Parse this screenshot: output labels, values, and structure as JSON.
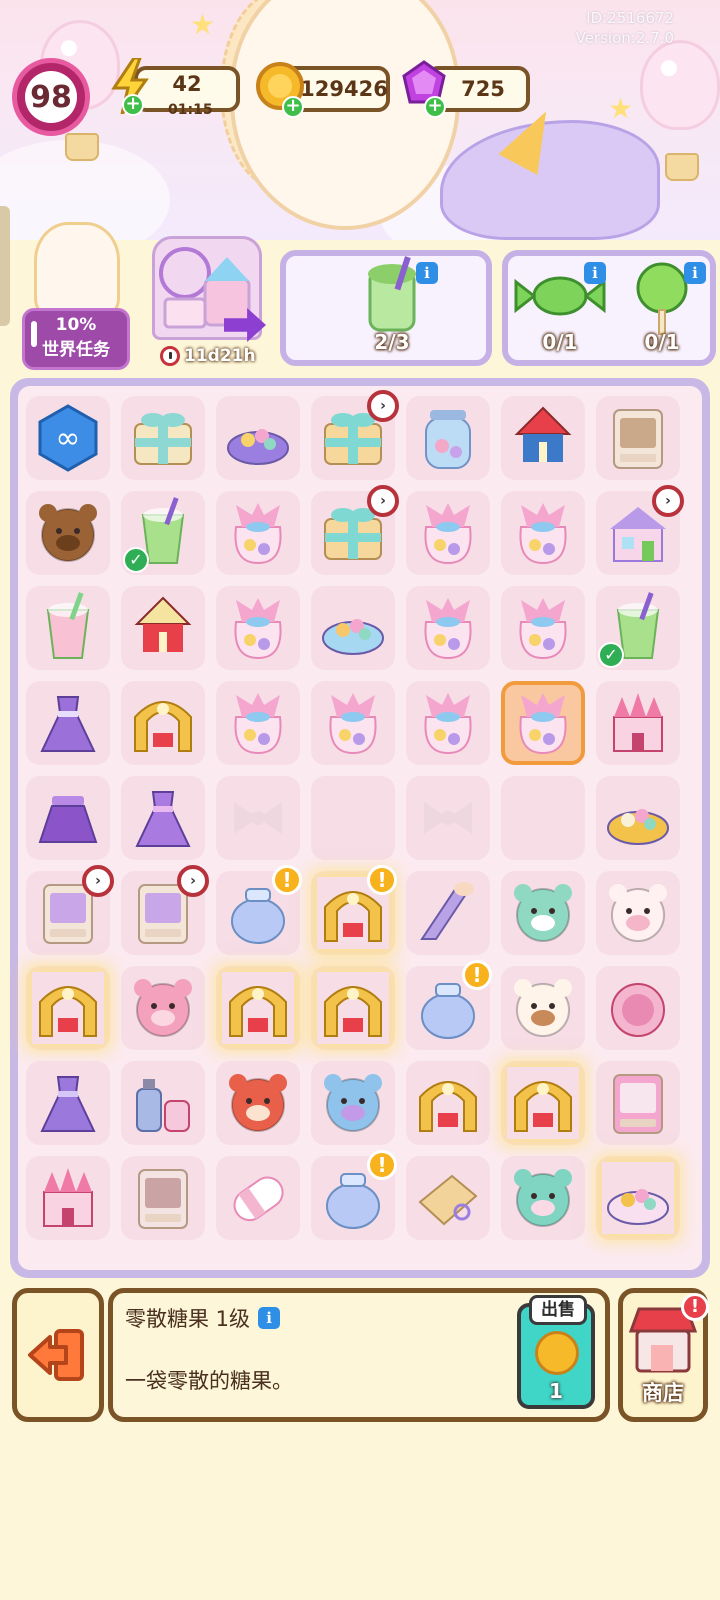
{
  "dev": {
    "id": "ID:2516672",
    "version": "Version:2.7.0"
  },
  "hud": {
    "level": "98",
    "energy": "42",
    "energy_timer": "01:15",
    "coins": "129426",
    "gems": "725"
  },
  "tasks": {
    "world_percent": "10%",
    "world_label": "世界任务",
    "event_timer": "11d21h"
  },
  "orders": [
    {
      "items": [
        {
          "icon": "matcha-drink-icon",
          "count": "2/3"
        }
      ]
    },
    {
      "items": [
        {
          "icon": "green-candy-icon",
          "count": "0/1"
        },
        {
          "icon": "green-lollipop-icon",
          "count": "0/1"
        }
      ]
    }
  ],
  "board": {
    "cols": 7,
    "rows": 9,
    "selected": [
      3,
      5
    ],
    "cells": [
      [
        "infinity-hexagon-icon",
        "teal-ribbon-gift-icon",
        "candy-tray-icon",
        "teal-gift-box-icon",
        "candy-jar-icon",
        "swing-ride-icon",
        "dresser-icon"
      ],
      [
        "teddy-bear-icon",
        "matcha-drink-icon",
        "candy-bag-icon",
        "teal-gift-box-icon",
        "candy-bag-icon",
        "candy-bag-icon",
        "purple-shop-icon"
      ],
      [
        "strawberry-drink-icon",
        "carousel-icon",
        "candy-bag-icon",
        "candy-plate-icon",
        "candy-bag-icon",
        "candy-bag-icon",
        "matcha-drink-icon"
      ],
      [
        "purple-dress-icon",
        "golden-stage-icon",
        "candy-bag-icon",
        "candy-bag-icon",
        "candy-bag-icon",
        "candy-bag-icon",
        "pink-castle-icon"
      ],
      [
        "purple-skirt-icon",
        "purple-jacket-icon",
        "bow-icon",
        "",
        "bow-icon",
        "",
        "teacup-ride-icon"
      ],
      [
        "wardrobe-icon",
        "wardrobe-icon",
        "glass-jar-icon",
        "golden-stage-icon",
        "makeup-brush-icon",
        "seal-plush-icon",
        "sheep-plush-icon"
      ],
      [
        "golden-stage-icon",
        "bunny-plush-icon",
        "golden-stage-icon",
        "golden-stage-icon",
        "glass-jar-icon",
        "puppy-plush-icon",
        "compact-mirror-icon"
      ],
      [
        "purple-gown-icon",
        "perfume-set-icon",
        "hamster-plush-icon",
        "cat-plush-icon",
        "golden-stage-icon",
        "golden-stage-icon",
        "makeup-palette-icon"
      ],
      [
        "pink-castle-icon",
        "nightstand-icon",
        "marshmallow-icon",
        "glass-jar-icon",
        "sewing-pattern-icon",
        "elephant-plush-icon",
        "ride-parts-icon"
      ]
    ],
    "markers": {
      "check": [
        "1-1",
        "2-6"
      ],
      "cooldown": [
        "0-3",
        "1-3",
        "1-6",
        "5-0",
        "5-1"
      ],
      "alert": [
        "5-2",
        "5-3",
        "6-4",
        "8-3"
      ],
      "glow": [
        "5-3",
        "6-0",
        "6-2",
        "6-3",
        "7-5",
        "8-6"
      ],
      "dim": [
        "4-2",
        "4-4"
      ]
    }
  },
  "selected_item": {
    "name": "零散糖果 1级",
    "description": "一袋零散的糖果。",
    "sell_label": "出售",
    "sell_price": "1"
  },
  "shop": {
    "label": "商店"
  },
  "colors": {
    "board_border": "#c8b8e6",
    "panel_border": "#7a5327",
    "accent_teal": "#3fd6c8",
    "level_pink": "#b3276a"
  }
}
